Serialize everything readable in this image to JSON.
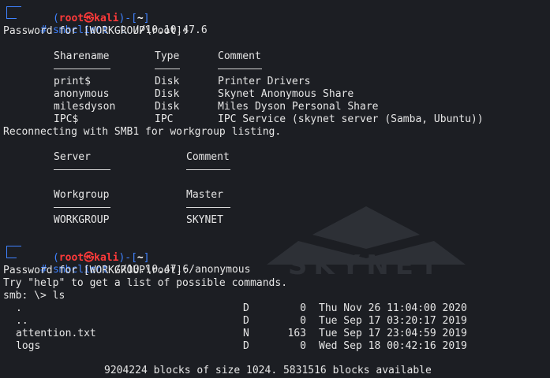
{
  "prompt1": {
    "user": "root",
    "at_symbol": "㉿",
    "host": "kali",
    "cwd": "~",
    "hash": "#",
    "command": "smbclient",
    "option": "-L",
    "target": "//10.10.47.6"
  },
  "password_line": "Password for [WORKGROUP\\root]:",
  "share_table": {
    "headers": [
      "Sharename",
      "Type",
      "Comment"
    ],
    "rows": [
      [
        "print$",
        "Disk",
        "Printer Drivers"
      ],
      [
        "anonymous",
        "Disk",
        "Skynet Anonymous Share"
      ],
      [
        "milesdyson",
        "Disk",
        "Miles Dyson Personal Share"
      ],
      [
        "IPC$",
        "IPC",
        "IPC Service (skynet server (Samba, Ubuntu))"
      ]
    ]
  },
  "reconnect_line": "Reconnecting with SMB1 for workgroup listing.",
  "server_table": {
    "headers": [
      "Server",
      "Comment"
    ]
  },
  "workgroup_table": {
    "headers": [
      "Workgroup",
      "Master"
    ],
    "rows": [
      [
        "WORKGROUP",
        "SKYNET"
      ]
    ]
  },
  "prompt2": {
    "user": "root",
    "at_symbol": "㉿",
    "host": "kali",
    "cwd": "~",
    "hash": "#",
    "command": "smbclient",
    "target": "//10.10.47.6/anonymous"
  },
  "password_line2": "Password for [WORKGROUP\\root]:",
  "help_line": "Try \"help\" to get a list of possible commands.",
  "smb_prompt": "smb: \\> ls",
  "ls_listing": [
    {
      "name": ".",
      "attr": "D",
      "size": "0",
      "date": "Thu Nov 26 11:04:00 2020"
    },
    {
      "name": "..",
      "attr": "D",
      "size": "0",
      "date": "Tue Sep 17 03:20:17 2019"
    },
    {
      "name": "attention.txt",
      "attr": "N",
      "size": "163",
      "date": "Tue Sep 17 23:04:59 2019"
    },
    {
      "name": "logs",
      "attr": "D",
      "size": "0",
      "date": "Wed Sep 18 00:42:16 2019"
    }
  ],
  "blocks_line": "9204224 blocks of size 1024. 5831516 blocks available",
  "watermark_text": "SKYNET",
  "colors": {
    "background": "#1c1e23",
    "prompt_blue": "#3f82ff",
    "prompt_red": "#ff3a3a",
    "text": "#e6e6e6"
  }
}
